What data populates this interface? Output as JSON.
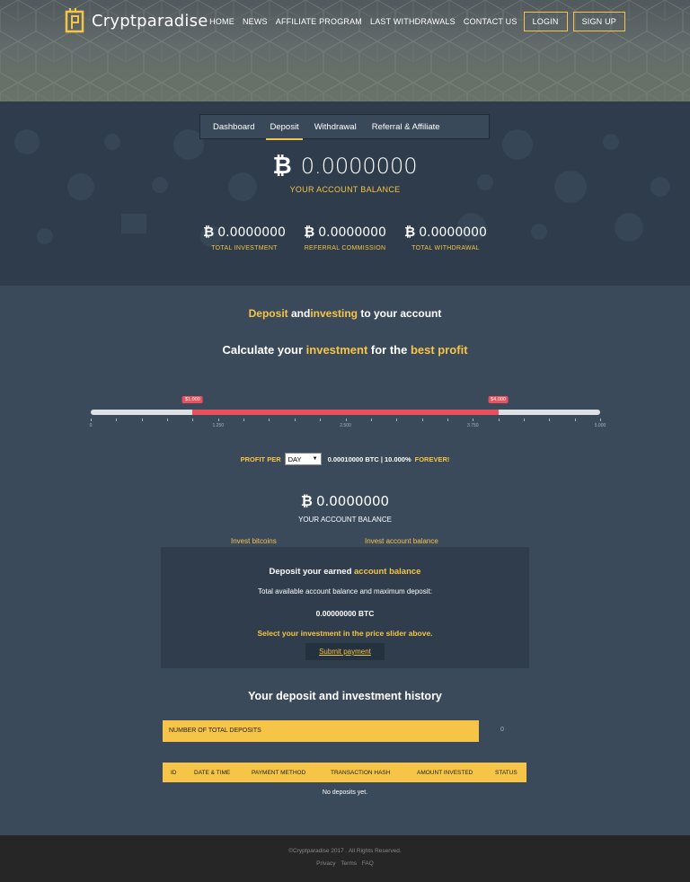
{
  "brand": {
    "name": "Cryptparadise"
  },
  "nav": {
    "items": [
      "HOME",
      "NEWS",
      "AFFILIATE PROGRAM",
      "LAST WITHDRAWALS",
      "CONTACT US"
    ],
    "login": "LOGIN",
    "signup": "SIGN UP"
  },
  "dashboard": {
    "tabs": [
      "Dashboard",
      "Deposit",
      "Withdrawal",
      "Referral & Affiliate"
    ],
    "active_tab": "Deposit",
    "balance": "0.0000000",
    "balance_label": "YOUR ACCOUNT BALANCE",
    "stats": [
      {
        "value": "0.0000000",
        "label": "TOTAL INVESTMENT"
      },
      {
        "value": "0.0000000",
        "label": "REFERRAL COMMISSION"
      },
      {
        "value": "0.0000000",
        "label": "TOTAL WITHDRAWAL"
      }
    ]
  },
  "deposit": {
    "heading": {
      "part1": "Deposit",
      "part2": " and",
      "part3": "investing",
      "part4": " to your account"
    },
    "calc": {
      "part1": "Calculate your ",
      "part2": "investment",
      "part3": " for the ",
      "part4": "best profit"
    },
    "slider": {
      "min_label": "$1.000",
      "max_label": "$4.000",
      "range_min": 0,
      "range_max": 5000,
      "selected_min": 1000,
      "selected_max": 4000,
      "ticks": [
        "0",
        "1.250",
        "2.500",
        "3.750",
        "5.000"
      ]
    },
    "profit": {
      "label": "PROFIT PER",
      "period": "DAY",
      "value": "0.00010000 BTC | 10.000%",
      "forever": "FOREVER!"
    },
    "balance": "0.0000000",
    "balance_label": "YOUR ACCOUNT BALANCE",
    "invest_tabs": [
      "Invest bitcoins",
      "Invest account balance"
    ],
    "box": {
      "title1": "Deposit your earned ",
      "title2": "account balance",
      "desc": "Total available account balance and maximum deposit:",
      "amount": "0.00000000 BTC",
      "hint": "Select your investment in the price slider above.",
      "submit": "Submit payment"
    },
    "history_title": "Your deposit and investment history",
    "total_label": "NUMBER OF TOTAL DEPOSITS",
    "total_count": "0",
    "columns": [
      "ID",
      "DATE & TIME",
      "PAYMENT METHOD",
      "TRANSACTION HASH",
      "AMOUNT INVESTED",
      "STATUS"
    ],
    "empty": "No deposits yet."
  },
  "footer": {
    "copyright": "©Cryptparadise 2017 . All Rights Reserved.",
    "links": [
      "Privacy",
      "Terms",
      "FAQ"
    ]
  },
  "colors": {
    "accent": "#f6c447",
    "slider_range": "#e8505b",
    "bg_main": "#3b4a5b",
    "bg_dark": "#2e3c4b"
  }
}
